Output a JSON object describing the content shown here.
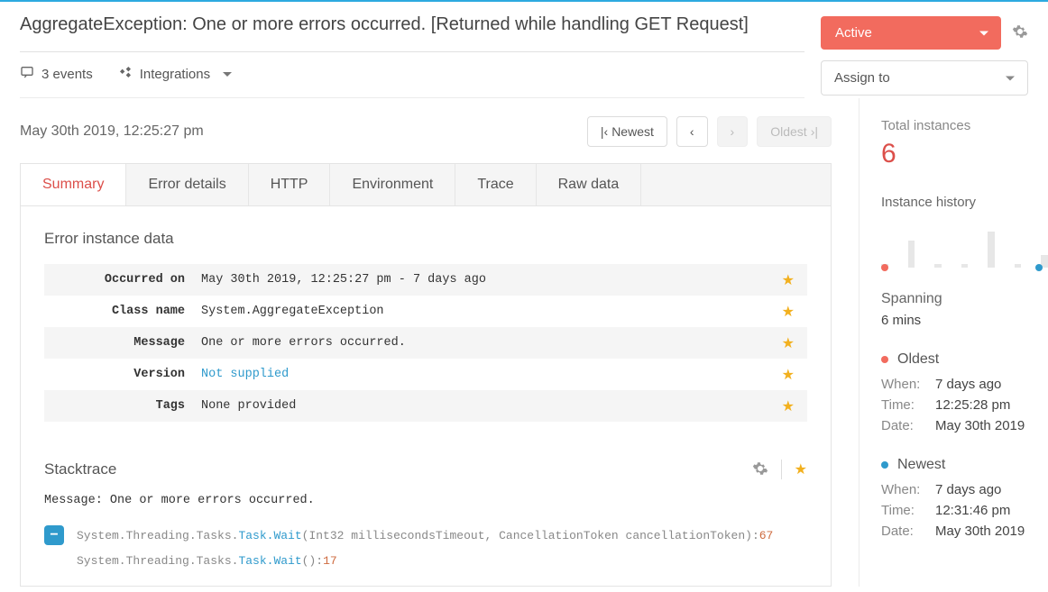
{
  "header": {
    "title": "AggregateException: One or more errors occurred. [Returned while handling GET Request]",
    "events_count": "3 events",
    "integrations_label": "Integrations",
    "status_label": "Active",
    "assign_label": "Assign to"
  },
  "meta": {
    "timestamp": "May 30th 2019, 12:25:27 pm",
    "pager": {
      "newest": "Newest",
      "oldest": "Oldest"
    }
  },
  "tabs": [
    "Summary",
    "Error details",
    "HTTP",
    "Environment",
    "Trace",
    "Raw data"
  ],
  "active_tab_index": 0,
  "error_instance": {
    "section_title": "Error instance data",
    "rows": [
      {
        "label": "Occurred on",
        "value": "May 30th 2019, 12:25:27 pm - 7 days ago",
        "link": false
      },
      {
        "label": "Class name",
        "value": "System.AggregateException",
        "link": false
      },
      {
        "label": "Message",
        "value": "One or more errors occurred.",
        "link": false
      },
      {
        "label": "Version",
        "value": "Not supplied",
        "link": true
      },
      {
        "label": "Tags",
        "value": "None provided",
        "link": false
      }
    ]
  },
  "stacktrace": {
    "title": "Stacktrace",
    "message": "Message: One or more errors occurred.",
    "frames": [
      {
        "pre": "System.Threading.Tasks.",
        "hl": "Task.Wait",
        "post": "(Int32 millisecondsTimeout, CancellationToken cancellationToken):",
        "line": "67",
        "toggle": true
      },
      {
        "pre": "System.Threading.Tasks.",
        "hl": "Task.Wait",
        "post": "():",
        "line": "17",
        "toggle": false
      }
    ]
  },
  "sidebar": {
    "total_label": "Total instances",
    "total_value": "6",
    "history_label": "Instance history",
    "spanning_label": "Spanning",
    "spanning_value": "6 mins",
    "oldest": {
      "title": "Oldest",
      "when_label": "When:",
      "when": "7 days ago",
      "time_label": "Time:",
      "time": "12:25:28 pm",
      "date_label": "Date:",
      "date": "May 30th 2019"
    },
    "newest": {
      "title": "Newest",
      "when_label": "When:",
      "when": "7 days ago",
      "time_label": "Time:",
      "time": "12:31:46 pm",
      "date_label": "Date:",
      "date": "May 30th 2019"
    }
  },
  "chart_data": {
    "type": "bar",
    "title": "Instance history",
    "categories": [
      "",
      "",
      "",
      "",
      "",
      "",
      ""
    ],
    "values": [
      0,
      2,
      0,
      0,
      3,
      0,
      1
    ],
    "ylim": [
      0,
      3
    ]
  }
}
